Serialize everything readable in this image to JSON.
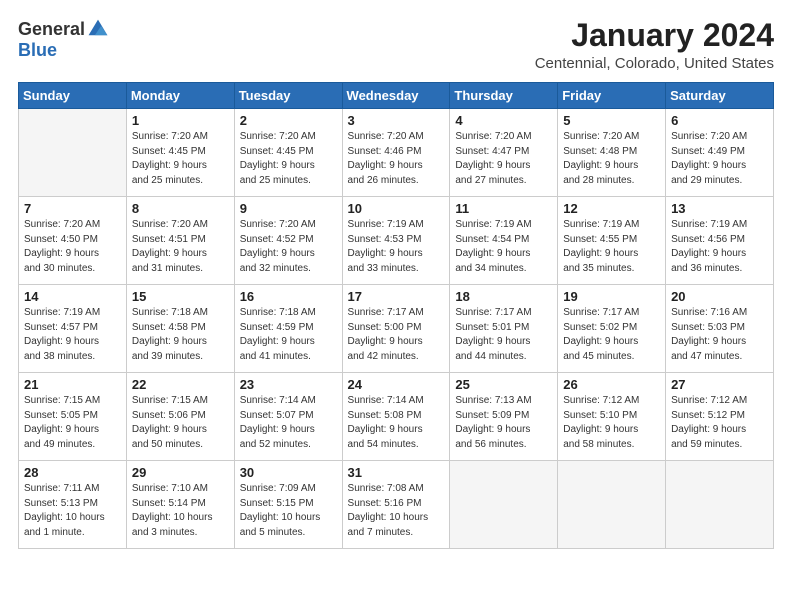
{
  "logo": {
    "general": "General",
    "blue": "Blue"
  },
  "title": "January 2024",
  "location": "Centennial, Colorado, United States",
  "days_of_week": [
    "Sunday",
    "Monday",
    "Tuesday",
    "Wednesday",
    "Thursday",
    "Friday",
    "Saturday"
  ],
  "weeks": [
    [
      {
        "day": "",
        "info": ""
      },
      {
        "day": "1",
        "info": "Sunrise: 7:20 AM\nSunset: 4:45 PM\nDaylight: 9 hours\nand 25 minutes."
      },
      {
        "day": "2",
        "info": "Sunrise: 7:20 AM\nSunset: 4:45 PM\nDaylight: 9 hours\nand 25 minutes."
      },
      {
        "day": "3",
        "info": "Sunrise: 7:20 AM\nSunset: 4:46 PM\nDaylight: 9 hours\nand 26 minutes."
      },
      {
        "day": "4",
        "info": "Sunrise: 7:20 AM\nSunset: 4:47 PM\nDaylight: 9 hours\nand 27 minutes."
      },
      {
        "day": "5",
        "info": "Sunrise: 7:20 AM\nSunset: 4:48 PM\nDaylight: 9 hours\nand 28 minutes."
      },
      {
        "day": "6",
        "info": "Sunrise: 7:20 AM\nSunset: 4:49 PM\nDaylight: 9 hours\nand 29 minutes."
      }
    ],
    [
      {
        "day": "7",
        "info": "Sunrise: 7:20 AM\nSunset: 4:50 PM\nDaylight: 9 hours\nand 30 minutes."
      },
      {
        "day": "8",
        "info": "Sunrise: 7:20 AM\nSunset: 4:51 PM\nDaylight: 9 hours\nand 31 minutes."
      },
      {
        "day": "9",
        "info": "Sunrise: 7:20 AM\nSunset: 4:52 PM\nDaylight: 9 hours\nand 32 minutes."
      },
      {
        "day": "10",
        "info": "Sunrise: 7:19 AM\nSunset: 4:53 PM\nDaylight: 9 hours\nand 33 minutes."
      },
      {
        "day": "11",
        "info": "Sunrise: 7:19 AM\nSunset: 4:54 PM\nDaylight: 9 hours\nand 34 minutes."
      },
      {
        "day": "12",
        "info": "Sunrise: 7:19 AM\nSunset: 4:55 PM\nDaylight: 9 hours\nand 35 minutes."
      },
      {
        "day": "13",
        "info": "Sunrise: 7:19 AM\nSunset: 4:56 PM\nDaylight: 9 hours\nand 36 minutes."
      }
    ],
    [
      {
        "day": "14",
        "info": "Sunrise: 7:19 AM\nSunset: 4:57 PM\nDaylight: 9 hours\nand 38 minutes."
      },
      {
        "day": "15",
        "info": "Sunrise: 7:18 AM\nSunset: 4:58 PM\nDaylight: 9 hours\nand 39 minutes."
      },
      {
        "day": "16",
        "info": "Sunrise: 7:18 AM\nSunset: 4:59 PM\nDaylight: 9 hours\nand 41 minutes."
      },
      {
        "day": "17",
        "info": "Sunrise: 7:17 AM\nSunset: 5:00 PM\nDaylight: 9 hours\nand 42 minutes."
      },
      {
        "day": "18",
        "info": "Sunrise: 7:17 AM\nSunset: 5:01 PM\nDaylight: 9 hours\nand 44 minutes."
      },
      {
        "day": "19",
        "info": "Sunrise: 7:17 AM\nSunset: 5:02 PM\nDaylight: 9 hours\nand 45 minutes."
      },
      {
        "day": "20",
        "info": "Sunrise: 7:16 AM\nSunset: 5:03 PM\nDaylight: 9 hours\nand 47 minutes."
      }
    ],
    [
      {
        "day": "21",
        "info": "Sunrise: 7:15 AM\nSunset: 5:05 PM\nDaylight: 9 hours\nand 49 minutes."
      },
      {
        "day": "22",
        "info": "Sunrise: 7:15 AM\nSunset: 5:06 PM\nDaylight: 9 hours\nand 50 minutes."
      },
      {
        "day": "23",
        "info": "Sunrise: 7:14 AM\nSunset: 5:07 PM\nDaylight: 9 hours\nand 52 minutes."
      },
      {
        "day": "24",
        "info": "Sunrise: 7:14 AM\nSunset: 5:08 PM\nDaylight: 9 hours\nand 54 minutes."
      },
      {
        "day": "25",
        "info": "Sunrise: 7:13 AM\nSunset: 5:09 PM\nDaylight: 9 hours\nand 56 minutes."
      },
      {
        "day": "26",
        "info": "Sunrise: 7:12 AM\nSunset: 5:10 PM\nDaylight: 9 hours\nand 58 minutes."
      },
      {
        "day": "27",
        "info": "Sunrise: 7:12 AM\nSunset: 5:12 PM\nDaylight: 9 hours\nand 59 minutes."
      }
    ],
    [
      {
        "day": "28",
        "info": "Sunrise: 7:11 AM\nSunset: 5:13 PM\nDaylight: 10 hours\nand 1 minute."
      },
      {
        "day": "29",
        "info": "Sunrise: 7:10 AM\nSunset: 5:14 PM\nDaylight: 10 hours\nand 3 minutes."
      },
      {
        "day": "30",
        "info": "Sunrise: 7:09 AM\nSunset: 5:15 PM\nDaylight: 10 hours\nand 5 minutes."
      },
      {
        "day": "31",
        "info": "Sunrise: 7:08 AM\nSunset: 5:16 PM\nDaylight: 10 hours\nand 7 minutes."
      },
      {
        "day": "",
        "info": ""
      },
      {
        "day": "",
        "info": ""
      },
      {
        "day": "",
        "info": ""
      }
    ]
  ]
}
